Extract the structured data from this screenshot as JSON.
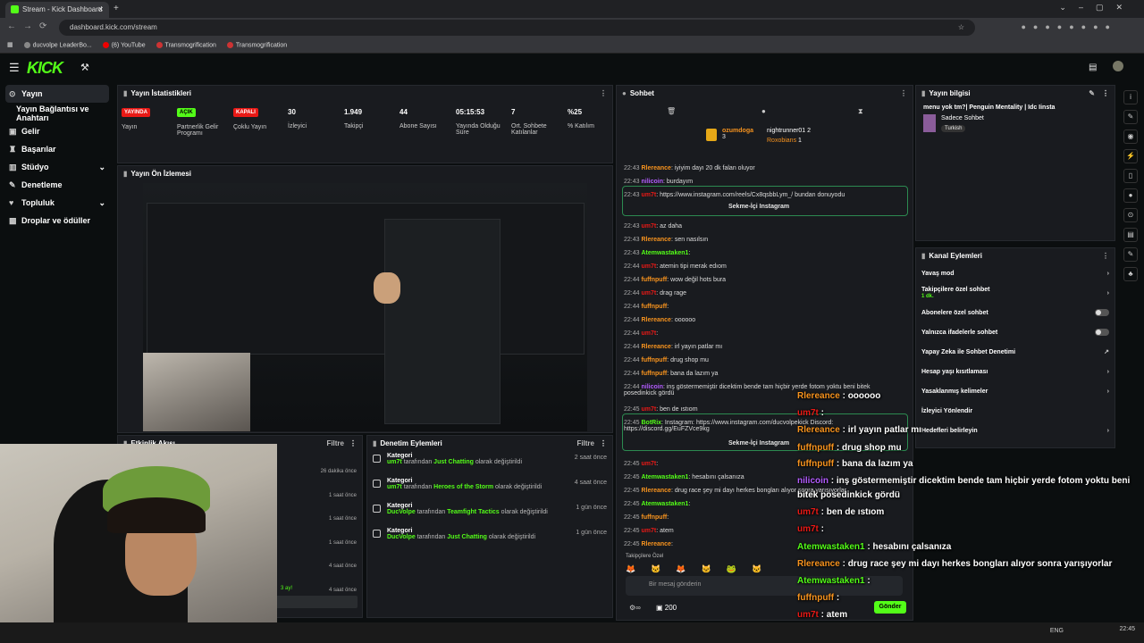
{
  "browser": {
    "tab_title": "Stream - Kick Dashboard",
    "url": "dashboard.kick.com/stream",
    "bookmarks": [
      "ducvolpe LeaderBo...",
      "(6) YouTube",
      "Transmogrification",
      "Transmogrification"
    ]
  },
  "sidebar": {
    "items": [
      {
        "label": "Yayın",
        "icon": "broadcast-icon"
      },
      {
        "label": "Yayın Bağlantısı ve Anahtarı"
      },
      {
        "label": "Gelir",
        "icon": "money-icon"
      },
      {
        "label": "Başarılar",
        "icon": "trophy-icon"
      },
      {
        "label": "Stüdyo",
        "icon": "studio-icon"
      },
      {
        "label": "Denetleme",
        "icon": "wrench-icon"
      },
      {
        "label": "Topluluk",
        "icon": "community-icon"
      },
      {
        "label": "Droplar ve ödüller",
        "icon": "gift-icon"
      }
    ]
  },
  "stats": {
    "title": "Yayın İstatistikleri",
    "items": [
      {
        "badge": "YAYINDA",
        "badge_color": "#e91916",
        "label": "Yayın"
      },
      {
        "badge": "AÇIK",
        "badge_color": "#53fc18",
        "label": "Partnerlik Gelir Programı"
      },
      {
        "badge": "KAPALI",
        "badge_color": "#e91916",
        "label": "Çoklu Yayın"
      },
      {
        "value": "30",
        "label": "İzleyici"
      },
      {
        "value": "1.949",
        "label": "Takipçi"
      },
      {
        "value": "44",
        "label": "Abone Sayısı"
      },
      {
        "value": "05:15:53",
        "label": "Yayında Olduğu Süre"
      },
      {
        "value": "7",
        "label": "Ort. Sohbete Katılanlar"
      },
      {
        "value": "%25",
        "label": "% Katılım"
      }
    ]
  },
  "preview": {
    "title": "Yayın Ön İzlemesi"
  },
  "activity": {
    "title": "Etkinlik Akışı",
    "filter": "Filtre",
    "times": [
      "26 dakika önce",
      "1 saat önce",
      "1 saat önce",
      "1 saat önce",
      "4 saat önce",
      "4 saat önce"
    ],
    "extra": "3 ay!"
  },
  "mod": {
    "title": "Denetim Eylemleri",
    "filter": "Filtre",
    "rows": [
      {
        "k": "Kategori",
        "user": "um7t",
        "mid": "tarafından",
        "cat": "Just Chatting",
        "end": "olarak değiştirildi",
        "t": "2 saat önce"
      },
      {
        "k": "Kategori",
        "user": "um7t",
        "mid": "tarafından",
        "cat": "Heroes of the Storm",
        "end": "olarak değiştirildi",
        "t": "4 saat önce"
      },
      {
        "k": "Kategori",
        "user": "DucVolpe",
        "mid": "tarafından",
        "cat": "Teamfight Tactics",
        "end": "olarak değiştirildi",
        "t": "1 gün önce"
      },
      {
        "k": "Kategori",
        "user": "DucVolpe",
        "mid": "tarafından",
        "cat": "Just Chatting",
        "end": "olarak değiştirildi",
        "t": "1 gün önce"
      }
    ]
  },
  "chat": {
    "title": "Sohbet",
    "leaders": [
      {
        "name": "ozumdoga",
        "n": "3"
      },
      {
        "name": "nightrunner01",
        "n": "2"
      },
      {
        "name": "Roxobians",
        "n": "1"
      }
    ],
    "popular": "Sekme-İçi Instagram",
    "popular2": "Sekme-İçi Instagram",
    "followers_only": "Takipçilere Özel",
    "placeholder": "Bir mesaj gönderin",
    "viewers": "200",
    "send": "Gönder",
    "messages": [
      {
        "t": "22:43",
        "u": "Rlereance",
        "c": "#f7931e",
        "m": ": iyiyim dayı 20 dk falan oluyor"
      },
      {
        "t": "22:43",
        "u": "nilicoin",
        "c": "#b35cff",
        "m": ": burdayım"
      },
      {
        "t": "22:43",
        "u": "um7t",
        "c": "#e91916",
        "m": ": https://www.instagram.com/reels/Cx8qsbbLym_/ bundan donuyodu"
      },
      {
        "t": "22:43",
        "u": "um7t",
        "c": "#e91916",
        "m": ": az daha"
      },
      {
        "t": "22:43",
        "u": "Rlereance",
        "c": "#f7931e",
        "m": ": sen nasılsın"
      },
      {
        "t": "22:43",
        "u": "Atemwastaken1",
        "c": "#53fc18",
        "m": ":"
      },
      {
        "t": "22:44",
        "u": "um7t",
        "c": "#e91916",
        "m": ": atemin tipi merak edıom"
      },
      {
        "t": "22:44",
        "u": "fuffnpuff",
        "c": "#f7931e",
        "m": ": wow değil hots bura"
      },
      {
        "t": "22:44",
        "u": "um7t",
        "c": "#e91916",
        "m": ": drag rage"
      },
      {
        "t": "22:44",
        "u": "fuffnpuff",
        "c": "#f7931e",
        "m": ":"
      },
      {
        "t": "22:44",
        "u": "Rlereance",
        "c": "#f7931e",
        "m": ": oooooo"
      },
      {
        "t": "22:44",
        "u": "um7t",
        "c": "#e91916",
        "m": ":"
      },
      {
        "t": "22:44",
        "u": "Rlereance",
        "c": "#f7931e",
        "m": ": irl yayın patlar mı"
      },
      {
        "t": "22:44",
        "u": "fuffnpuff",
        "c": "#f7931e",
        "m": ": drug shop mu"
      },
      {
        "t": "22:44",
        "u": "fuffnpuff",
        "c": "#f7931e",
        "m": ": bana da lazım ya"
      },
      {
        "t": "22:44",
        "u": "nilicoin",
        "c": "#b35cff",
        "m": ": inş göstermemiştir dicektim bende tam hiçbir yerde fotom yoktu beni bitek posedinkick gördü"
      },
      {
        "t": "22:45",
        "u": "um7t",
        "c": "#e91916",
        "m": ": ben de ıstıom"
      },
      {
        "t": "22:45",
        "u": "BotRix",
        "c": "#53fc18",
        "m": ": Instagram: https://www.instagram.com/ducvolpekick Discord: https://discord.gg/EuFZVce9kg"
      },
      {
        "t": "22:45",
        "u": "um7t",
        "c": "#e91916",
        "m": ":"
      },
      {
        "t": "22:45",
        "u": "Atemwastaken1",
        "c": "#53fc18",
        "m": ": hesabını çalsanıza"
      },
      {
        "t": "22:45",
        "u": "Rlereance",
        "c": "#f7931e",
        "m": ": drug race şey mi dayı herkes bongları alıyor sonra yarışıyorlar"
      },
      {
        "t": "22:45",
        "u": "Atemwastaken1",
        "c": "#53fc18",
        "m": ":"
      },
      {
        "t": "22:45",
        "u": "fuffnpuff",
        "c": "#f7931e",
        "m": ":"
      },
      {
        "t": "22:45",
        "u": "um7t",
        "c": "#e91916",
        "m": ": atem"
      },
      {
        "t": "22:45",
        "u": "Rlereance",
        "c": "#f7931e",
        "m": ":"
      }
    ]
  },
  "info": {
    "title": "Yayın bilgisi",
    "stream_title": "menu yok tm?| Penguin Mentality | Idc Iinsta",
    "category": "Sadece Sohbet",
    "tag": "Turkish"
  },
  "actions": {
    "title": "Kanal Eylemleri",
    "rows": [
      {
        "label": "Yavaş mod",
        "r": "›"
      },
      {
        "label": "Takipçilere özel sohbet",
        "sub": "1 dk.",
        "r": "›"
      },
      {
        "label": "Abonelere özel sohbet",
        "toggle": true
      },
      {
        "label": "Yalnızca ifadelerle sohbet",
        "toggle": true
      },
      {
        "label": "Yapay Zeka ile Sohbet Denetimi",
        "r": "↗"
      },
      {
        "label": "Hesap yaşı kısıtlaması",
        "r": "›"
      },
      {
        "label": "Yasaklanmış kelimeler",
        "r": "›"
      },
      {
        "label": "İzleyici Yönlendir",
        "r": ""
      },
      {
        "label": "Hedefleri belirleyin",
        "r": "›"
      }
    ]
  },
  "overlay": [
    {
      "u": "Rlereance",
      "c": "o",
      "m": " : oooooo"
    },
    {
      "u": "um7t",
      "c": "r",
      "m": " :"
    },
    {
      "u": "Rlereance",
      "c": "o",
      "m": " : irl yayın patlar mı"
    },
    {
      "u": "fuffnpuff",
      "c": "o",
      "m": " : drug shop mu"
    },
    {
      "u": "fuffnpuff",
      "c": "o",
      "m": " : bana da lazım ya"
    },
    {
      "u": "nilicoin",
      "c": "p",
      "m": " : inş göstermemiştir dicektim bende tam hiçbir yerde fotom yoktu beni"
    },
    {
      "u": "",
      "c": "",
      "m": "bitek posedinkick gördü"
    },
    {
      "u": "um7t",
      "c": "r",
      "m": " : ben de ıstıom"
    },
    {
      "u": "um7t",
      "c": "r",
      "m": " :"
    },
    {
      "u": "Atemwastaken1",
      "c": "gr",
      "m": " : hesabını çalsanıza"
    },
    {
      "u": "Rlereance",
      "c": "o",
      "m": " : drug race şey mi dayı herkes bongları alıyor sonra yarışıyorlar"
    },
    {
      "u": "Atemwastaken1",
      "c": "gr",
      "m": " :"
    },
    {
      "u": "fuffnpuff",
      "c": "o",
      "m": " :"
    },
    {
      "u": "um7t",
      "c": "r",
      "m": " : atem"
    },
    {
      "u": "Rlereance",
      "c": "o",
      "m": " :"
    }
  ],
  "taskbar": {
    "lang": "ENG",
    "time": "22:45"
  }
}
